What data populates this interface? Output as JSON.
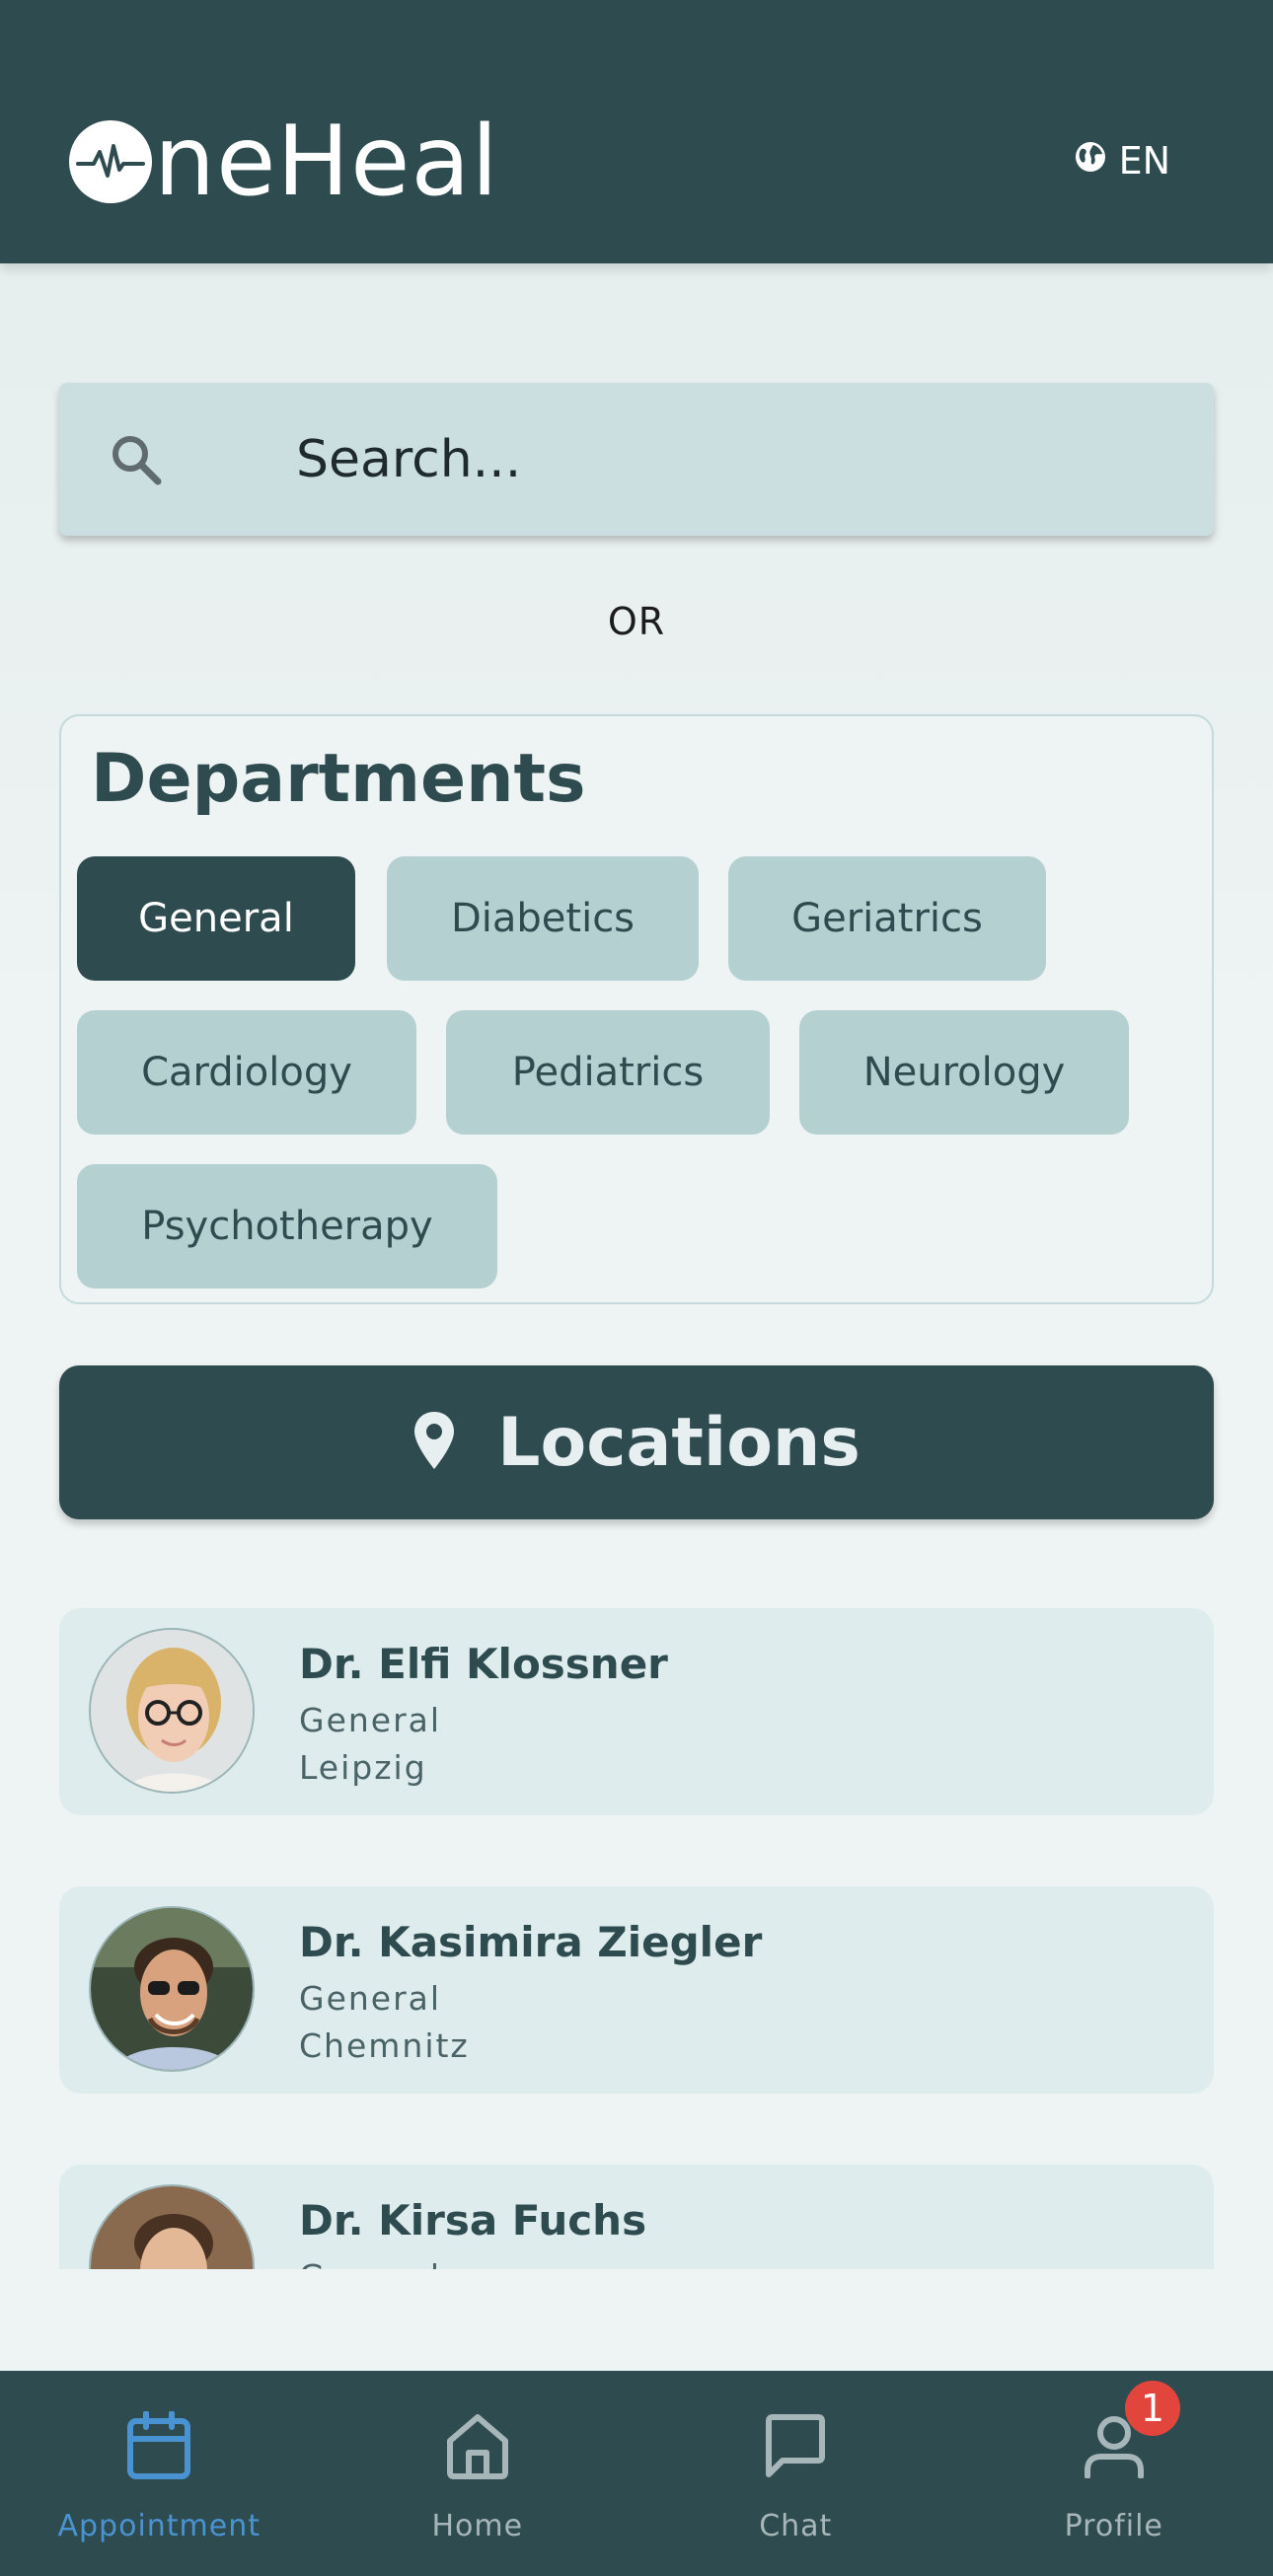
{
  "header": {
    "logo_text": "neHeal",
    "logo_full": "OneHeal",
    "language": "EN",
    "language_icon": "globe-icon"
  },
  "search": {
    "placeholder": "Search...",
    "value": "",
    "icon": "search-icon"
  },
  "or_text": "OR",
  "departments": {
    "title": "Departments",
    "chips": [
      {
        "label": "General",
        "selected": true
      },
      {
        "label": "Diabetics",
        "selected": false
      },
      {
        "label": "Geriatrics",
        "selected": false
      },
      {
        "label": "Cardiology",
        "selected": false
      },
      {
        "label": "Pediatrics",
        "selected": false
      },
      {
        "label": "Neurology",
        "selected": false
      },
      {
        "label": "Psychotherapy",
        "selected": false
      }
    ]
  },
  "locations_button": {
    "label": "Locations",
    "icon": "location-pin-icon"
  },
  "doctors": [
    {
      "name": "Dr. Elfi Klossner",
      "department": "General",
      "city": "Leipzig"
    },
    {
      "name": "Dr. Kasimira Ziegler",
      "department": "General",
      "city": "Chemnitz"
    },
    {
      "name": "Dr. Kirsa Fuchs",
      "department": "General",
      "city": ""
    }
  ],
  "bottom_nav": {
    "items": [
      {
        "label": "Appointment",
        "icon": "calendar-icon",
        "active": true
      },
      {
        "label": "Home",
        "icon": "home-icon",
        "active": false
      },
      {
        "label": "Chat",
        "icon": "chat-bubble-icon",
        "active": false
      },
      {
        "label": "Profile",
        "icon": "user-icon",
        "active": false
      }
    ],
    "profile_badge": "1"
  },
  "colors": {
    "primary": "#2e4b4f",
    "chip_bg": "#b4d0d1",
    "card_bg": "#dfeced",
    "nav_active": "#4a93d2",
    "badge": "#e2453c"
  }
}
